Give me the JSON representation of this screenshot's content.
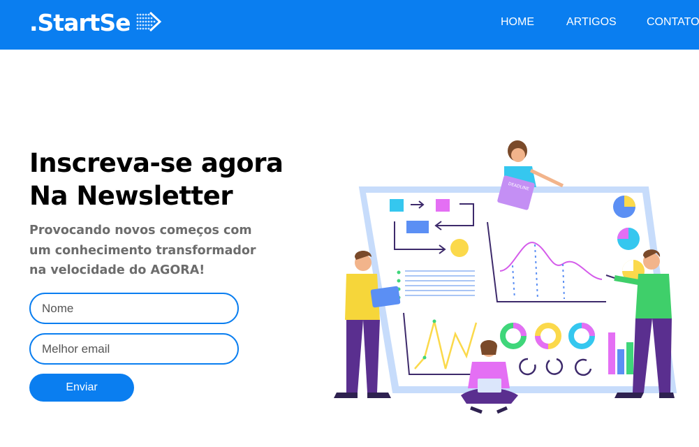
{
  "header": {
    "logo_text": ".StartSe",
    "brand_color": "#0a7ef0",
    "nav": [
      {
        "label": "HOME"
      },
      {
        "label": "ARTIGOS"
      },
      {
        "label": "CONTATO"
      }
    ]
  },
  "hero": {
    "title_line1": "Inscreva-se agora",
    "title_line2": "Na Newsletter",
    "subtitle": "Provocando novos começos com um conhecimento transformador na velocidade do AGORA!",
    "form": {
      "name_placeholder": "Nome",
      "email_placeholder": "Melhor email",
      "submit_label": "Enviar"
    }
  },
  "illustration": {
    "board_label": "DEADLINE"
  }
}
